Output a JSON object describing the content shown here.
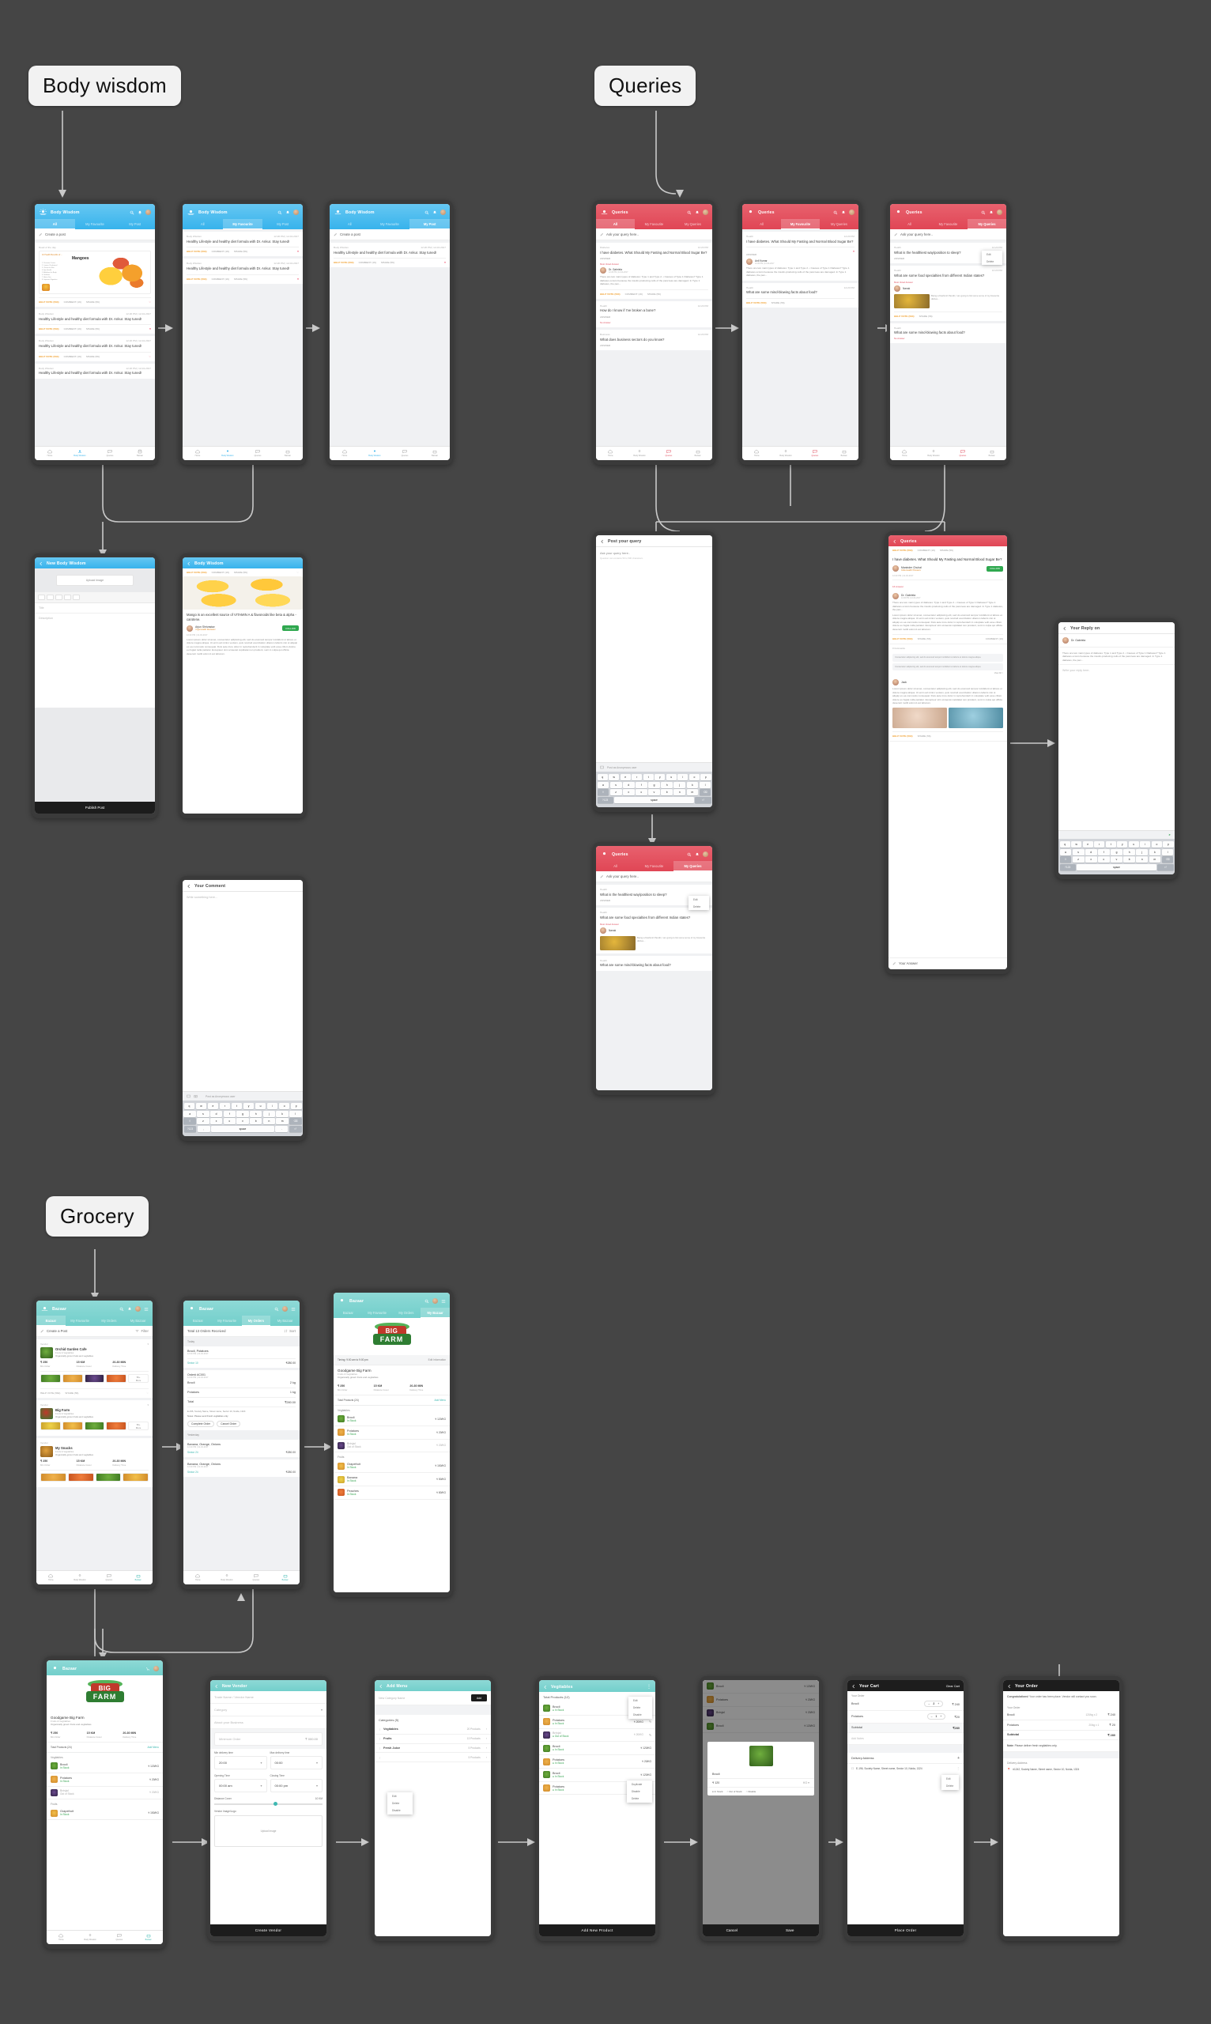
{
  "sections": [
    {
      "id": "body-wisdom",
      "label": "Body wisdom"
    },
    {
      "id": "queries",
      "label": "Queries"
    },
    {
      "id": "grocery",
      "label": "Grocery"
    }
  ],
  "apps": {
    "body_wisdom": {
      "title": "Body Wisdom",
      "tabs": [
        "All",
        "My Favourite",
        "My Post"
      ],
      "create_post": "Create a post",
      "read_of_day": "Read of the day",
      "featured_card": {
        "kicker": "10 Health Benefits of ...",
        "headline": "Mangoes",
        "summary": "Mango is an excellent source of VITAMIN A & flavonoids like beta & alpha - carotene.",
        "side_note": "Lorem ipsum dolor sit amet, consectetur adipiscing elit, sed do eiusmod."
      },
      "posts": [
        {
          "author": "Body Wisdom",
          "time": "12:20 PM | 12-04-2017",
          "text": "Healthy Lifestyle and healthy diet formula with Dr. Ankur. Stay tuned!"
        },
        {
          "author": "Body Wisdom",
          "time": "12:20 PM | 12-04-2017",
          "text": "Healthy Lifestyle and healthy diet formula with Dr. Ankur. Stay tuned!"
        },
        {
          "author": "Body Wisdom",
          "time": "12:20 PM | 12-04-2017",
          "text": "Healthy Lifestyle and healthy diet formula with Dr. Ankur. Stay tuned!"
        },
        {
          "author": "Body Wisdom",
          "time": "12:20 PM | 12-04-2017",
          "text": "Healthy Lifestyle and healthy diet formula with Dr. Ankur. Stay tuned!"
        }
      ],
      "actions": {
        "vote": "HELP VOTE (564)",
        "comment": "COMMENT (16)",
        "share": "SHARE (56)"
      },
      "bottom_nav": [
        "Home",
        "Body Wisdom",
        "Queries",
        "Bazaar"
      ],
      "detail": {
        "back_title": "Body Wisdom",
        "headline": "Mango is an excellent source of VITAMIN A & flavonoids like beta & alpha - carotene.",
        "author": "Arjun Shrivastav",
        "author_sub": "Yoga Health Reviewer",
        "follow": "FOLLOW",
        "time": "12:20 PM | 12-04-2017",
        "body": "Lorem ipsum dolor sit amet, consectetur adipiscing elit, sed do eiusmod tempor incididunt ut labore et dolore magna aliqua. Ut enim ad minim veniam, quis nostrud exercitation ullamco laboris nisi ut aliquip ex ea commodo consequat. Duis aute irure dolor in reprehenderit in voluptate velit esse cillum dolore eu fugiat nulla pariatur. Excepteur sint occaecat cupidatat non proident, sunt in culpa qui officia deserunt mollit anim id est laborum."
      },
      "new_post": {
        "title": "New Body Wisdom",
        "upload": "Upload Image",
        "field_title": "Title",
        "field_desc": "Description",
        "publish": "Publish Post"
      },
      "comment": {
        "title": "Your Comment",
        "placeholder": "Write something here...",
        "anon": "Post as Anonymous user"
      }
    },
    "queries": {
      "title": "Queries",
      "tabs": [
        "All",
        "My Favourite",
        "My Queries"
      ],
      "ask_placeholder": "Ask your query here..",
      "items": [
        {
          "tag": "Diabetes",
          "time": "12:20 PM",
          "q": "I have diabetes. What Should My Fasting and Normal Blood Sugar Be?",
          "answer_label": "ANSWER"
        },
        {
          "tag": "Health",
          "time": "12:20 PM",
          "q": "How do I know if I've broken a bone?",
          "answer_label": "ANSWER"
        },
        {
          "tag": "Business",
          "time": "12:20 PM",
          "q": "What does business sectors do you know?",
          "answer_label": "ANSWER"
        },
        {
          "tag": "Health",
          "time": "12:20 PM",
          "q": "What are some food specialties from different Indian states?",
          "answer_label": "ANSWER"
        },
        {
          "tag": "Health",
          "time": "12:20 PM",
          "q": "What are some mind-blowing facts about food?",
          "answer_label": "ANSWER"
        },
        {
          "tag": "Health",
          "time": "12:20 PM",
          "q": "What is the healthiest way/position to sleep?",
          "answer_label": "ANSWER"
        }
      ],
      "most_voted": "Most Voted Answer",
      "no_answer": "No Answer",
      "doctor": {
        "name": "Dr. Gabriela",
        "time": "12:20 PM | 12-04-2017"
      },
      "answer_body": "There are two main types of diabetes: Type 1 and Type 2.\n• Causes of Type 1 Diabetes?\nType 1 diabetes occurs because the insulin-producing cells of the pancreas are damaged. In Type 1 diabetes, the pan...",
      "detail": {
        "back_title": "Queries",
        "question": "I have diabetes. What Should My Fasting and Normal Blood Sugar Be?",
        "asker": "Maninder Chuhal",
        "asker_sub": "India Health Pioneers",
        "follow": "FOLLOW",
        "time": "12:20 PM | 12-04-2017",
        "answers_count": "16 Answer",
        "view_all": "View All >",
        "comments_count": "0 Comments",
        "your_answer": "Your Answer"
      },
      "post_query": {
        "title": "Post your query",
        "placeholder": "Ask your query here..",
        "sub": "Question can contains 50 to 500 characters.",
        "anon": "Post as Anonymous user"
      },
      "reply": {
        "title": "Your Reply on",
        "doctor": "Dr. Gabriela",
        "placeholder": "Write your reply here.."
      },
      "bottom_nav": [
        "Home",
        "Body Wisdom",
        "Queries",
        "Bazaar"
      ]
    },
    "grocery": {
      "title": "Bazaar",
      "tabs": [
        "Bazaar",
        "My Favourite",
        "My Orders",
        "My Bazaar"
      ],
      "create_post": "Create a Post",
      "filter": "Filter",
      "vendors": [
        {
          "label": "Vendor",
          "name": "Orchid Garden Cafe",
          "cat": "Fruits & Vegitables",
          "desc": "Organically grown fruits and vegitables",
          "min": "₹ 250",
          "min_l": "Min Order",
          "dist": "15 KM",
          "dist_l": "Distance Cover",
          "time": "20-30 MIN",
          "time_l": "Delivery Time",
          "more": "50+"
        },
        {
          "label": "Vendor",
          "name": "Big Farm",
          "cat": "Fruits & Vegitables",
          "desc": "Organically grown fruits and vegitables",
          "min": "₹ 250",
          "min_l": "Min Order",
          "dist": "15 KM",
          "dist_l": "Distance Cover",
          "time": "20-30 MIN",
          "time_l": "Delivery Time",
          "more": "50+"
        },
        {
          "label": "Vendor",
          "name": "My Snacks",
          "cat": "Fruits & Vegitables",
          "desc": "Organically grown fruits and vegitables",
          "min": "₹ 250",
          "min_l": "Min Order",
          "dist": "15 KM",
          "dist_l": "Distance Cover",
          "time": "20-30 MIN",
          "time_l": "Delivery Time",
          "more": "50+"
        }
      ],
      "more_label": "More",
      "orders": {
        "total": "Total 13 Orders Received",
        "sort": "Sort",
        "today": "Today",
        "yesterday": "Yesterday",
        "rows": [
          {
            "items": "Brocli, Potatoes",
            "time": "12:20 PM | 12-04-2017",
            "addr": "Sector 10",
            "amt": "₹280.00"
          },
          {
            "order_no": "Order# AC001",
            "time": "12:20 PM | 12-04-2017",
            "lines": [
              {
                "n": "Brocli",
                "q": "2 kg"
              },
              {
                "n": "Potatoes",
                "q": "1 kg"
              }
            ],
            "total_l": "Total",
            "total": "₹280.00",
            "addr": "E-196, Society Name, Street name, Sector 10, Noida, 1324",
            "note": "Notes: Please send Fresh vegitables only.",
            "complete": "Complete Order",
            "cancel": "Cancel Order"
          },
          {
            "items": "Banana, Orange, Onions",
            "time": "12:20 PM | 12-04-2017",
            "addr": "Sector 24",
            "amt": "₹280.00"
          },
          {
            "items": "Banana, Orange, Onions",
            "time": "12:20 PM | 12-04-2017",
            "addr": "Sector 24",
            "amt": "₹280.00"
          }
        ]
      },
      "my_bazaar": {
        "timing": "Timing: 9:00 am to 9:00 pm",
        "edit": "Edit Information",
        "name": "Goodgame Big Farm",
        "cat": "Fruits & Vegitables",
        "desc": "Organically grown fruits and vegitables",
        "min": "₹ 250",
        "min_l": "Min Order",
        "dist": "15 KM",
        "dist_l": "Distance Cover",
        "time": "20-30 MIN",
        "time_l": "Delivery Time",
        "total_products": "Total Products (24)",
        "add_menu": "Add Menu",
        "groups": [
          {
            "title": "Vegitables",
            "items": [
              {
                "n": "Brocli",
                "s": "In Stock",
                "p": "₹ 120/KG"
              },
              {
                "n": "Potatoes",
                "s": "In Stock",
                "p": "₹ 20/KG"
              },
              {
                "n": "Brinjal",
                "s": "Out of Stock",
                "p": "₹ 20/KG"
              }
            ]
          },
          {
            "title": "Fruits",
            "items": [
              {
                "n": "Grapefruit",
                "s": "In Stock",
                "p": "₹ 150/KG"
              },
              {
                "n": "Banana",
                "s": "In Stock",
                "p": "₹ 50/KG"
              },
              {
                "n": "Peaches",
                "s": "In Stock",
                "p": "₹ 80/KG"
              }
            ]
          }
        ]
      },
      "new_vendor": {
        "title": "New Vendor",
        "name_ph": "Trade Name / Vendor Name",
        "category_ph": "Category",
        "about_ph": "About your Business",
        "min_order_ph": "Minimum Order",
        "min_order_val": "₹ 000.00",
        "min_delivery_l": "Min delivery time",
        "min_delivery_v": "20:00",
        "max_delivery_l": "Max delivery time",
        "max_delivery_v": "00:00",
        "opening_l": "Opening Time",
        "opening_v": "00:00 am",
        "closing_l": "Closing Time",
        "closing_v": "00:00 pm",
        "distance_l": "Distance Cover",
        "distance_v": "10 KM",
        "vendor_image_l": "Vendor Image/Logo",
        "upload": "Upload Image",
        "create": "Create Vendor"
      },
      "add_menu": {
        "title": "Add Menu",
        "new_cat_ph": "New Category Name",
        "add": "Add",
        "categories_title": "Categories (5)",
        "rows": [
          {
            "n": "Vegitables",
            "c": "20 Products"
          },
          {
            "n": "Fruits",
            "c": "13 Products"
          },
          {
            "n": "Fresh Juice",
            "c": "5 Products"
          },
          {
            "n": "",
            "c": "5 Products"
          }
        ],
        "menu": [
          "Edit",
          "Delete",
          "Disable"
        ]
      },
      "product_list": {
        "title": "Vegitables",
        "total": "Total Products (12)",
        "in_stock": "In Stock",
        "out_stock": "Out of Stock",
        "menu1": [
          "Edit",
          "Delete",
          "Disable"
        ],
        "menu2": [
          "Duplicate",
          "Disable",
          "Delete"
        ],
        "items": [
          {
            "n": "Brocli",
            "p": "₹ 120/KG",
            "stock": "in"
          },
          {
            "n": "Potatoes",
            "p": "₹ 20/KG",
            "stock": "in"
          },
          {
            "n": "Brinjal",
            "p": "₹ 20/KG",
            "stock": "out"
          },
          {
            "n": "Brocli",
            "p": "₹ 120/KG",
            "stock": "in"
          },
          {
            "n": "Potatoes",
            "p": "₹ 20/KG",
            "stock": "in"
          },
          {
            "n": "Brocli",
            "p": "₹ 120/KG",
            "stock": "in"
          },
          {
            "n": "Potatoes",
            "p": "₹ 20/KG",
            "stock": "in"
          }
        ],
        "add_new": "Add New Product"
      },
      "new_product": {
        "name": "Brocli",
        "price": "₹ 120",
        "unit": "KG",
        "in_stock": "In Stock",
        "out_stock": "Out of Stock",
        "disable": "Disable",
        "cancel": "Cancel",
        "save": "Save"
      },
      "cart": {
        "title": "Your Cart",
        "clear": "Clear Cart",
        "your_order": "Your Order",
        "lines": [
          {
            "n": "Brocli",
            "q": "2",
            "p": "₹ 240"
          },
          {
            "n": "Potatoes",
            "q": "1",
            "p": "₹20"
          }
        ],
        "subtotal_l": "Subtotal",
        "subtotal": "₹280",
        "notes_ph": "Add Notes",
        "address_l": "Delivery Address",
        "address": "E-196, Society Name, Street name, Sector 10, Noida, 1324",
        "edit": "Edit",
        "delete": "Delete",
        "place_order": "Place Order"
      },
      "order_done": {
        "title": "Your Order",
        "congrats_b": "Congratulations!",
        "congrats": "Your order has been place. Vendor will contact you soon.",
        "your_order": "Your Order",
        "lines": [
          {
            "n": "Brocli",
            "u": "120/kg x 2",
            "p": "₹ 240"
          },
          {
            "n": "Potatoes",
            "u": "20/kg x 1",
            "p": "₹ 20"
          }
        ],
        "subtotal_l": "Subtotal",
        "subtotal": "₹ 280",
        "note_b": "Note:",
        "note": "Please deliver fresh vegitables only.",
        "address_l": "Delivery Address",
        "address": "#1242, Society Name, Street name, Sector 10, Noida, 1324"
      },
      "bottom_nav": [
        "Home",
        "Body Wisdom",
        "Queries",
        "Bazaar"
      ]
    }
  }
}
